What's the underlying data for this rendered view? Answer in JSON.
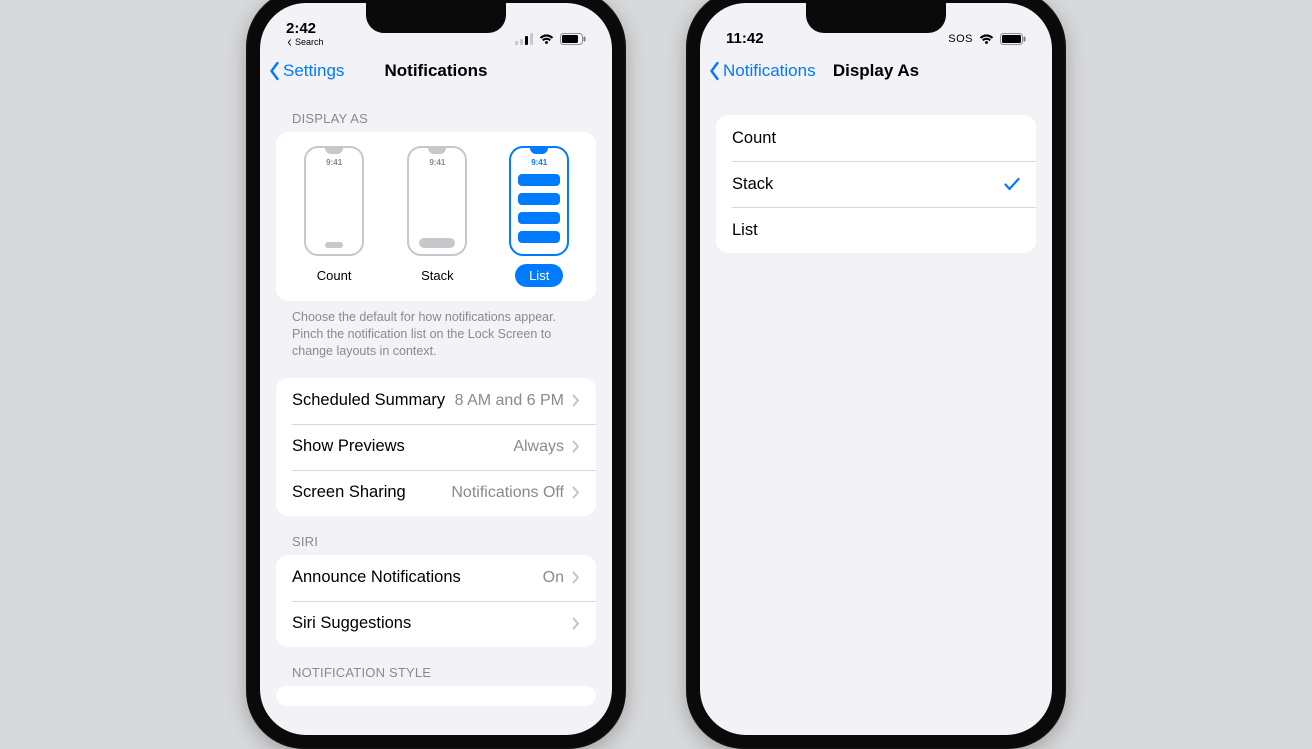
{
  "colors": {
    "tint": "#007aff",
    "bg": "#f2f2f7",
    "card": "#ffffff",
    "secondary": "#8a8a8e"
  },
  "left": {
    "status": {
      "time": "2:42",
      "breadcrumb": "Search"
    },
    "nav": {
      "back": "Settings",
      "title": "Notifications"
    },
    "display_as": {
      "header": "DISPLAY AS",
      "options": [
        {
          "key": "count",
          "label": "Count",
          "mini_time": "9:41",
          "selected": false
        },
        {
          "key": "stack",
          "label": "Stack",
          "mini_time": "9:41",
          "selected": false
        },
        {
          "key": "list",
          "label": "List",
          "mini_time": "9:41",
          "selected": true
        }
      ],
      "footer": "Choose the default for how notifications appear. Pinch the notification list on the Lock Screen to change layouts in context."
    },
    "rows1": [
      {
        "label": "Scheduled Summary",
        "value": "8 AM and 6 PM"
      },
      {
        "label": "Show Previews",
        "value": "Always"
      },
      {
        "label": "Screen Sharing",
        "value": "Notifications Off"
      }
    ],
    "siri_header": "SIRI",
    "rows2": [
      {
        "label": "Announce Notifications",
        "value": "On"
      },
      {
        "label": "Siri Suggestions",
        "value": ""
      }
    ],
    "style_header": "NOTIFICATION STYLE"
  },
  "right": {
    "status": {
      "time": "11:42",
      "carrier": "SOS"
    },
    "nav": {
      "back": "Notifications",
      "title": "Display As"
    },
    "options": [
      {
        "label": "Count",
        "checked": false
      },
      {
        "label": "Stack",
        "checked": true
      },
      {
        "label": "List",
        "checked": false
      }
    ]
  }
}
